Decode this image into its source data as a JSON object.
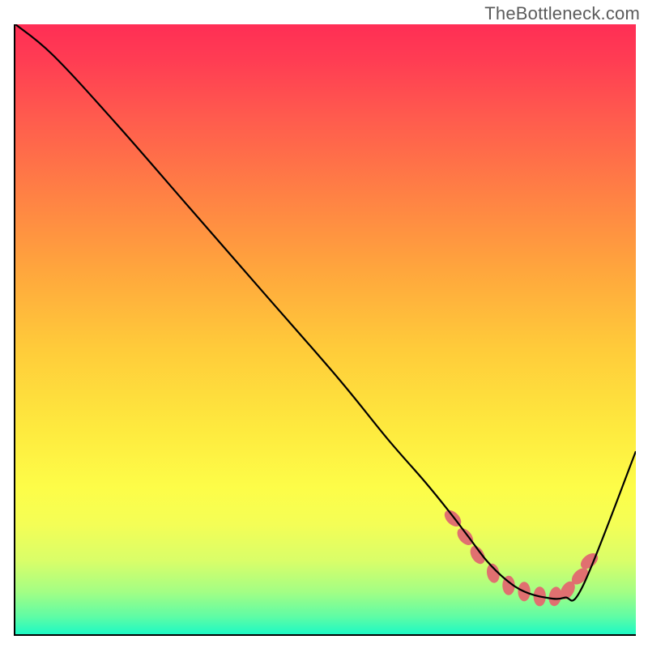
{
  "watermark": "TheBottleneck.com",
  "chart_data": {
    "type": "line",
    "title": "",
    "xlabel": "",
    "ylabel": "",
    "xlim": [
      0,
      100
    ],
    "ylim": [
      0,
      100
    ],
    "grid": false,
    "legend": false,
    "series": [
      {
        "name": "curve",
        "stroke": "#000000",
        "stroke_width": 2.2,
        "x": [
          0,
          6,
          16,
          28,
          40,
          52,
          60,
          66,
          70,
          73,
          76,
          79,
          82,
          85.5,
          88.5,
          91.5,
          100
        ],
        "values": [
          100,
          95,
          84,
          70,
          56,
          42,
          32,
          25,
          20,
          16,
          12,
          9,
          7,
          6,
          6,
          8,
          30
        ]
      },
      {
        "name": "markers",
        "type": "scatter",
        "marker_color": "#E07070",
        "rx": 1.0,
        "ry": 1.6,
        "rotations": [
          -45,
          -40,
          -30,
          -10,
          0,
          0,
          0,
          10,
          30,
          45,
          50
        ],
        "x": [
          70.5,
          72.5,
          74.5,
          77.0,
          79.5,
          82.0,
          84.5,
          87.0,
          89.0,
          91.0,
          92.5
        ],
        "values": [
          19.0,
          16.0,
          13.0,
          10.0,
          8.0,
          7.0,
          6.2,
          6.2,
          7.2,
          9.5,
          12.0
        ]
      }
    ],
    "gradient_stops": [
      {
        "pos": 0.0,
        "color": "#FF2E55"
      },
      {
        "pos": 0.06,
        "color": "#FF3D53"
      },
      {
        "pos": 0.15,
        "color": "#FF5A4E"
      },
      {
        "pos": 0.27,
        "color": "#FF7E45"
      },
      {
        "pos": 0.4,
        "color": "#FFA53D"
      },
      {
        "pos": 0.53,
        "color": "#FFCB3A"
      },
      {
        "pos": 0.66,
        "color": "#FEE93E"
      },
      {
        "pos": 0.76,
        "color": "#FDFD48"
      },
      {
        "pos": 0.82,
        "color": "#F4FE56"
      },
      {
        "pos": 0.88,
        "color": "#D9FE69"
      },
      {
        "pos": 0.93,
        "color": "#A4FE84"
      },
      {
        "pos": 0.97,
        "color": "#61FCA4"
      },
      {
        "pos": 1.0,
        "color": "#1DF9C4"
      }
    ]
  }
}
